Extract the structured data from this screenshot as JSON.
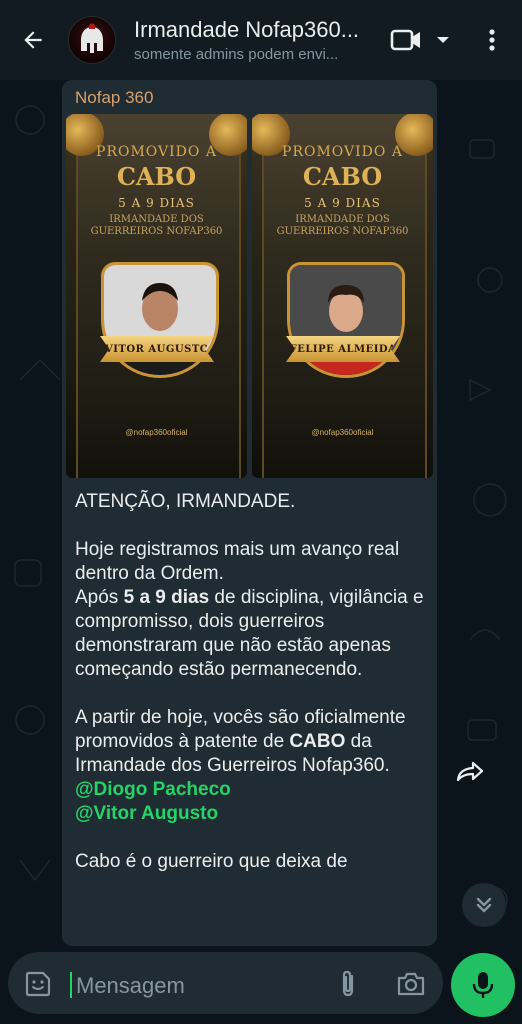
{
  "header": {
    "title": "Irmandade Nofap360...",
    "subtitle": "somente admins podem envi..."
  },
  "message": {
    "sender": "Nofap 360",
    "images": [
      {
        "line1": "PROMOVIDO A",
        "line2": "CABO",
        "line3": "5 A 9 DIAS",
        "line4": "IRMANDADE DOS",
        "line5": "GUERREIROS NOFAP360",
        "name": "VITOR AUGUSTO",
        "handle": "@nofap360oficial",
        "shirt": "#1b1b1b"
      },
      {
        "line1": "PROMOVIDO A",
        "line2": "CABO",
        "line3": "5 A 9 DIAS",
        "line4": "IRMANDADE DOS",
        "line5": "GUERREIROS NOFAP360",
        "name": "FELIPE ALMEIDA",
        "handle": "@nofap360oficial",
        "shirt": "#c4281e"
      }
    ],
    "p1": "ATENÇÃO, IRMANDADE.",
    "p2a": "Hoje registramos mais um avanço real dentro da Ordem.",
    "p2b_pre": "Após ",
    "p2b_bold": "5 a 9 dias",
    "p2b_post": " de disciplina, vigilância e compromisso, dois guerreiros demonstraram que não estão apenas começando estão permanecendo.",
    "p3_pre": "A partir de hoje, vocês são oficialmente promovidos à patente de ",
    "p3_bold": "CABO",
    "p3_post": " da Irmandade dos Guerreiros Nofap360.",
    "mention1": "@Diogo Pacheco",
    "mention2": "@Vitor Augusto",
    "p4": "Cabo é o guerreiro que deixa de"
  },
  "composer": {
    "placeholder": "Mensagem"
  },
  "colors": {
    "accent": "#25d366",
    "sender": "#d8a06a",
    "bubble": "#202c33",
    "header": "#111b21"
  }
}
